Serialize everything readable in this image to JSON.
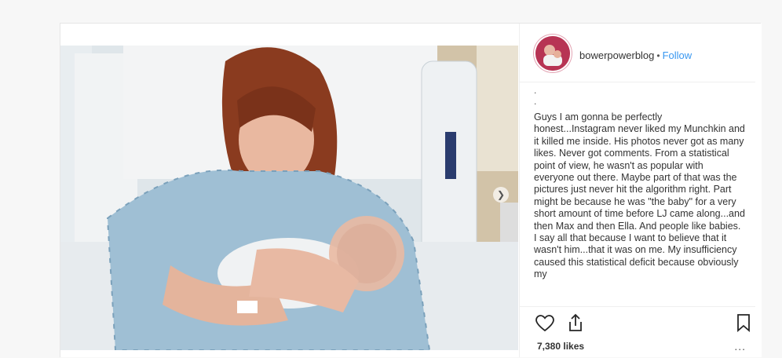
{
  "post": {
    "username": "bowerpowerblog",
    "separator": "•",
    "follow_label": "Follow",
    "caption_prefix": ".\n.",
    "caption": "Guys I am gonna be perfectly honest...Instagram never liked my Munchkin and it killed me inside. His photos never got as many likes. Never got comments. From a statistical point of view, he wasn't as popular with everyone out there. Maybe part of that was the pictures just never hit the algorithm right. Part might be because he was \"the baby\" for a very short amount of time before LJ came along...and then Max and then Ella. And people like babies. I say all that because I want to believe that it wasn't him...that it was on me. My insufficiency caused this statistical deficit because obviously my",
    "likes": "7,380 likes",
    "more": "...",
    "icons": {
      "like": "heart-icon",
      "share": "share-icon",
      "save": "bookmark-icon",
      "next": "chevron-right-icon"
    },
    "colors": {
      "link": "#3897f0",
      "border": "#efefef"
    }
  }
}
